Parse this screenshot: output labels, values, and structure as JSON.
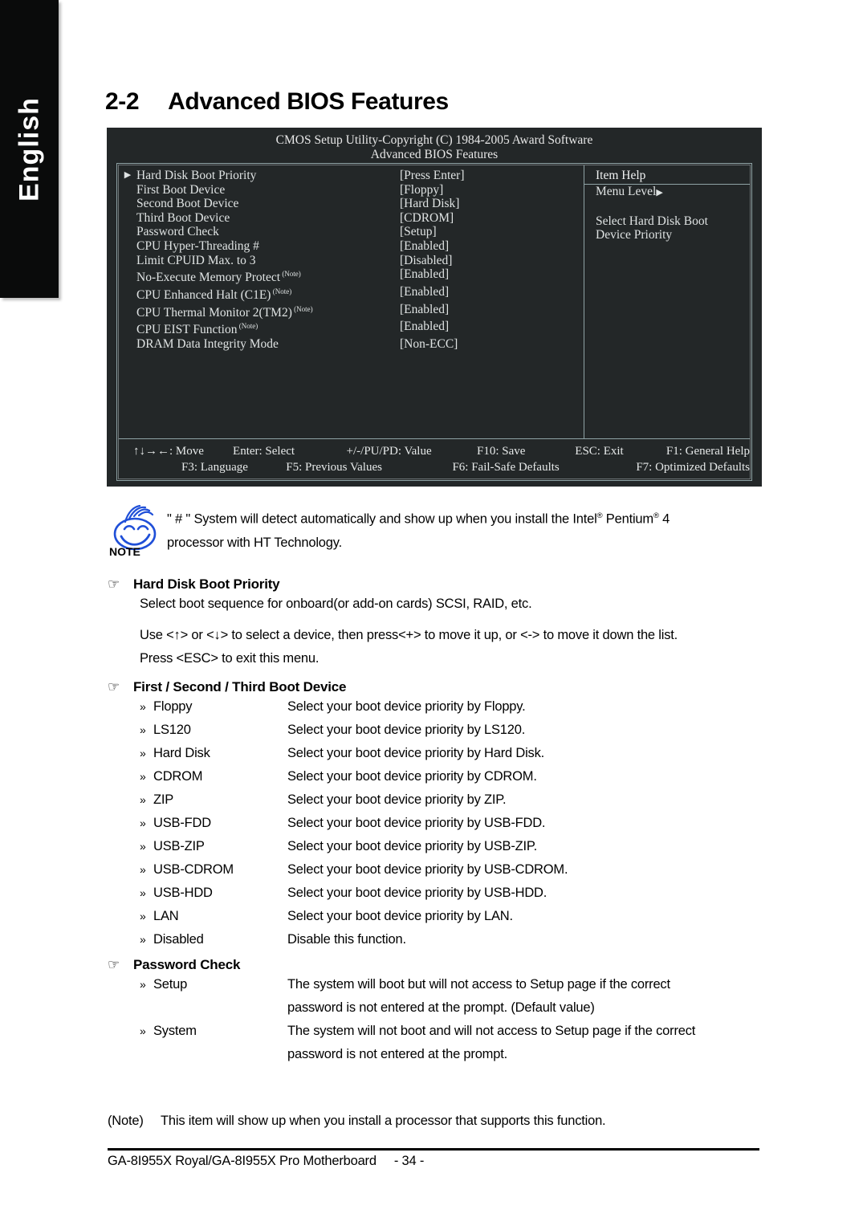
{
  "language_tab": {
    "label": "English"
  },
  "title": {
    "number": "2-2",
    "text": "Advanced BIOS Features"
  },
  "bios": {
    "header_line1": "CMOS Setup Utility-Copyright (C) 1984-2005 Award Software",
    "header_line2": "Advanced BIOS Features",
    "rows": [
      {
        "arrow": "▶",
        "name": "Hard Disk Boot Priority",
        "value": "[Press Enter]",
        "note": ""
      },
      {
        "arrow": "",
        "name": "First Boot Device",
        "value": "[Floppy]",
        "note": ""
      },
      {
        "arrow": "",
        "name": "Second Boot Device",
        "value": "[Hard Disk]",
        "note": ""
      },
      {
        "arrow": "",
        "name": "Third Boot Device",
        "value": "[CDROM]",
        "note": ""
      },
      {
        "arrow": "",
        "name": "Password Check",
        "value": "[Setup]",
        "note": ""
      },
      {
        "arrow": "",
        "name": "CPU Hyper-Threading #",
        "value": "[Enabled]",
        "note": ""
      },
      {
        "arrow": "",
        "name": "Limit CPUID Max. to 3",
        "value": "[Disabled]",
        "note": ""
      },
      {
        "arrow": "",
        "name": "No-Execute Memory Protect",
        "value": "[Enabled]",
        "note": "(Note)"
      },
      {
        "arrow": "",
        "name": "CPU Enhanced Halt (C1E)",
        "value": "[Enabled]",
        "note": "(Note)"
      },
      {
        "arrow": "",
        "name": "CPU Thermal Monitor 2(TM2)",
        "value": "[Enabled]",
        "note": "(Note)"
      },
      {
        "arrow": "",
        "name": "CPU EIST Function",
        "value": "[Enabled]",
        "note": "(Note)"
      },
      {
        "arrow": "",
        "name": "DRAM Data Integrity Mode",
        "value": "[Non-ECC]",
        "note": ""
      }
    ],
    "item_help": {
      "title": "Item Help",
      "menu_level": "Menu Level",
      "menu_level_arrow": "▶",
      "desc_line1": "Select Hard Disk Boot",
      "desc_line2": "Device Priority"
    },
    "footer": {
      "row1": [
        "↑↓→←: Move",
        "Enter: Select",
        "+/-/PU/PD: Value",
        "F10: Save",
        "ESC: Exit",
        "F1: General Help"
      ],
      "row2": [
        "F3: Language",
        "F5: Previous Values",
        "F6: Fail-Safe Defaults",
        "F7: Optimized Defaults"
      ]
    }
  },
  "note_callout": {
    "icon_label": "NOTE",
    "line1_a": "\" # \" System will detect automatically and show up when you install the Intel",
    "line1_sup1": "®",
    "line1_b": " Pentium",
    "line1_sup2": "®",
    "line1_c": " 4",
    "line2": "processor with HT Technology."
  },
  "sections": [
    {
      "bullet": "☞",
      "heading": "Hard Disk Boot Priority",
      "paragraphs": [
        "Select boot sequence for onboard(or add-on cards) SCSI, RAID, etc.",
        "Use <↑> or <↓> to select a device, then press<+> to move it up, or <-> to move it down the list.",
        "Press <ESC> to exit this menu."
      ]
    },
    {
      "bullet": "☞",
      "heading": "First / Second / Third Boot Device",
      "options": [
        {
          "bullet": "»",
          "name": "Floppy",
          "desc": "Select your boot device priority by Floppy."
        },
        {
          "bullet": "»",
          "name": "LS120",
          "desc": "Select your boot device priority by LS120."
        },
        {
          "bullet": "»",
          "name": "Hard Disk",
          "desc": "Select your boot device priority by Hard Disk."
        },
        {
          "bullet": "»",
          "name": "CDROM",
          "desc": "Select your boot device priority by CDROM."
        },
        {
          "bullet": "»",
          "name": "ZIP",
          "desc": "Select your boot device priority by ZIP."
        },
        {
          "bullet": "»",
          "name": "USB-FDD",
          "desc": "Select your boot device priority by USB-FDD."
        },
        {
          "bullet": "»",
          "name": "USB-ZIP",
          "desc": "Select your boot device priority by USB-ZIP."
        },
        {
          "bullet": "»",
          "name": "USB-CDROM",
          "desc": "Select your boot device priority by USB-CDROM."
        },
        {
          "bullet": "»",
          "name": "USB-HDD",
          "desc": "Select your boot device priority by USB-HDD."
        },
        {
          "bullet": "»",
          "name": "LAN",
          "desc": "Select your boot device priority by LAN."
        },
        {
          "bullet": "»",
          "name": "Disabled",
          "desc": "Disable this function."
        }
      ]
    },
    {
      "bullet": "☞",
      "heading": "Password Check",
      "options": [
        {
          "bullet": "»",
          "name": "Setup",
          "desc": "The system will boot but will not access to Setup page if the correct",
          "desc2": "password is not entered at the prompt. (Default value)"
        },
        {
          "bullet": "»",
          "name": "System",
          "desc": "The system will not boot and will not access to Setup page if the correct",
          "desc2": "password is not entered at the prompt."
        }
      ]
    }
  ],
  "bottom_note": {
    "label": "(Note)",
    "text": "This item will show up when you install a processor that supports this function."
  },
  "page_footer": {
    "product": "GA-8I955X Royal/GA-8I955X Pro Motherboard",
    "page": "- 34 -"
  }
}
